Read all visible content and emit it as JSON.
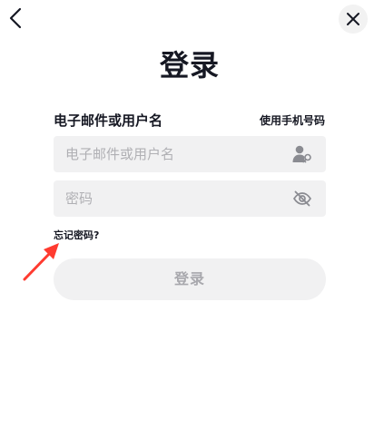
{
  "header": {
    "back_icon": "chevron-left-icon",
    "close_icon": "close-icon"
  },
  "title": "登录",
  "form": {
    "username_label": "电子邮件或用户名",
    "phone_link": "使用手机号码",
    "username_placeholder": "电子邮件或用户名",
    "username_value": "",
    "username_icon": "user-key-icon",
    "password_placeholder": "密码",
    "password_value": "",
    "password_icon": "eye-slash-icon",
    "forgot_link": "忘记密码?",
    "submit_label": "登录"
  },
  "annotation": {
    "arrow_color": "#ff3b30"
  },
  "colors": {
    "text_primary": "#161823",
    "input_bg": "#f1f1f2",
    "placeholder": "#b0b0b4",
    "button_disabled_text": "#a8a8ad"
  }
}
